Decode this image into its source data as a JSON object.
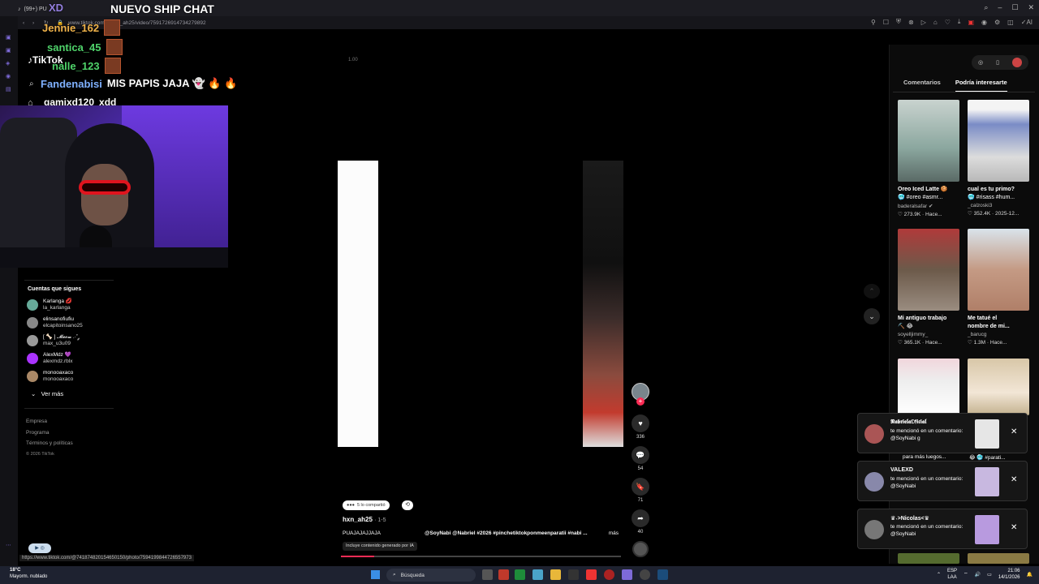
{
  "browser": {
    "tab_label": "(99+) PU",
    "url": "www.tiktok.com/@hxn_ah25/video/7591726914734279892",
    "window_controls": [
      "–",
      "☐",
      "✕"
    ]
  },
  "stream_overlay": {
    "title": "NUEVO SHIP CHAT",
    "title_partial": "XD",
    "chat": [
      {
        "user": "Jennie_162",
        "message": "",
        "color": "#f0b34a"
      },
      {
        "user": "santica_45",
        "message": "",
        "color": "#4fd36a"
      },
      {
        "user": "nalle_123",
        "message": "",
        "color": "#4fd36a"
      },
      {
        "user": "Fandenabisi",
        "message": "MIS PAPIS JAJA 👻 🔥 🔥",
        "color": "#7fb1ff"
      },
      {
        "user": "gamixd120",
        "message": "xdd",
        "color": "#ffffff"
      }
    ]
  },
  "tiktok_nav": {
    "logo": "TikTok",
    "following_title": "Cuentas que sigues",
    "following": [
      {
        "name": "Karlanga 💋",
        "handle": "la_karlanga",
        "color": "#6a9"
      },
      {
        "name": "elinsanofiufiu",
        "handle": "elcapitoinsano25",
        "color": "#888"
      },
      {
        "name": "[ 🦴 ] 𝓜𝓮𝓸𝔀 .·˚ ༘",
        "handle": "max_u3u09",
        "color": "#999"
      },
      {
        "name": "AlexMdz 💜",
        "handle": "alexmdz.rblx",
        "color": "#a3f"
      },
      {
        "name": "monooaxaco",
        "handle": "monooaxaco",
        "color": "#a86"
      }
    ],
    "see_more": "Ver más",
    "footer": [
      "Empresa",
      "Programa",
      "Términos y políticas"
    ],
    "copyright": "© 2026 TikTok"
  },
  "video": {
    "time_label": "1.00",
    "progress": 0.12,
    "shared_label": "5 lo compartió",
    "author": "hxn_ah25",
    "date": "· 1-5",
    "caption": "PUAJAJAJJAJA",
    "hashtags": "@SoyNabi @Nabriel #2026 #pinchetiktokponmeenparatii #nabi ...",
    "more": "más",
    "ai_label": "Incluye contenido generado por IA"
  },
  "actions": [
    {
      "name": "like",
      "icon": "♥",
      "count": "336"
    },
    {
      "name": "comment",
      "icon": "💬",
      "count": "54"
    },
    {
      "name": "save",
      "icon": "🔖",
      "count": "71"
    },
    {
      "name": "share",
      "icon": "➦",
      "count": "40"
    }
  ],
  "right_panel": {
    "tabs": [
      "Comentarios",
      "Podría interesarte"
    ],
    "active_tab": 1,
    "cards": [
      {
        "title": "Oreo Iced Latte 🍪",
        "subtitle": "🥶 #oreo #asmr...",
        "author": "baderalsafar ✔",
        "stats": "♡ 273.9K · Hace...",
        "thumb": "linear-gradient(180deg,#c9d3cf,#8aa69e 60%,#5a6a66)"
      },
      {
        "title": "cual es tu primo?",
        "subtitle": "🥶 #risass #hum...",
        "author": "_calzoski3",
        "stats": "♡ 352.4K · 2025-12...",
        "thumb": "linear-gradient(180deg,#f4f4f4 0%,#f4f4f4 12%,#7a8cc6 30%,#dcdcdc 70%,#b8b8b8)"
      },
      {
        "title": "Mi antiguo trabajo",
        "subtitle": "⛏️ 😂",
        "author": "soyelljimmy_",
        "stats": "♡ 365.1K · Hace...",
        "thumb": "linear-gradient(180deg,#b03a3a,#6c5a4a 50%,#9a8c80)"
      },
      {
        "title": "Me tatué el",
        "subtitle": "nombre de mi...",
        "author": "_barucg",
        "stats": "♡ 1.3M · Hace...",
        "thumb": "linear-gradient(180deg,#d9e3ea,#c49a84 50%,#b07f68)"
      },
      {
        "title": "",
        "subtitle": "",
        "author": "",
        "stats": "",
        "thumb": "linear-gradient(180deg,#f1d6dc,#eeeeee 40%,#ffffff)"
      },
      {
        "title": "",
        "subtitle": "",
        "author": "",
        "stats": "",
        "thumb": "linear-gradient(180deg,#d8c7a8,#f2e6d6 60%,#c3b18e)"
      }
    ],
    "partial_labels": {
      "left": "para más luegos...",
      "right": "😂 🥶 #parati..."
    }
  },
  "notifications": [
    {
      "name": "𝕹𝖆𝖇𝖗𝖎𝖊𝖑𝖆𝕺𝖋𝖎𝖈𝖎𝖆𝖑",
      "text": "te mencionó en un comentario: @SoyNabi g",
      "avatar": "#a55",
      "thumb": "#e6e6e6"
    },
    {
      "name": "VALEXD",
      "text": "te mencionó en un comentario: @SoyNabi",
      "avatar": "#88a",
      "thumb": "#c8b8e0"
    },
    {
      "name": "♛˖>Nicolas<♛",
      "text": "te mencionó en un comentario: @SoyNabi",
      "avatar": "#777",
      "thumb": "#b89adf"
    }
  ],
  "status_url": "https://www.tiktok.com/@741874820154650150/photo/7594199844726557973",
  "taskbar": {
    "weather_temp": "18°C",
    "weather_desc": "Mayorm. nublado",
    "search_placeholder": "Búsqueda",
    "lang": "ESP",
    "lang2": "LAA",
    "time": "21:06",
    "date": "14/1/2026"
  },
  "colors": {
    "tiktok_red": "#fe2c55",
    "opera_purple": "#7d6ad8",
    "taskbar_bg": "#1e2230"
  }
}
